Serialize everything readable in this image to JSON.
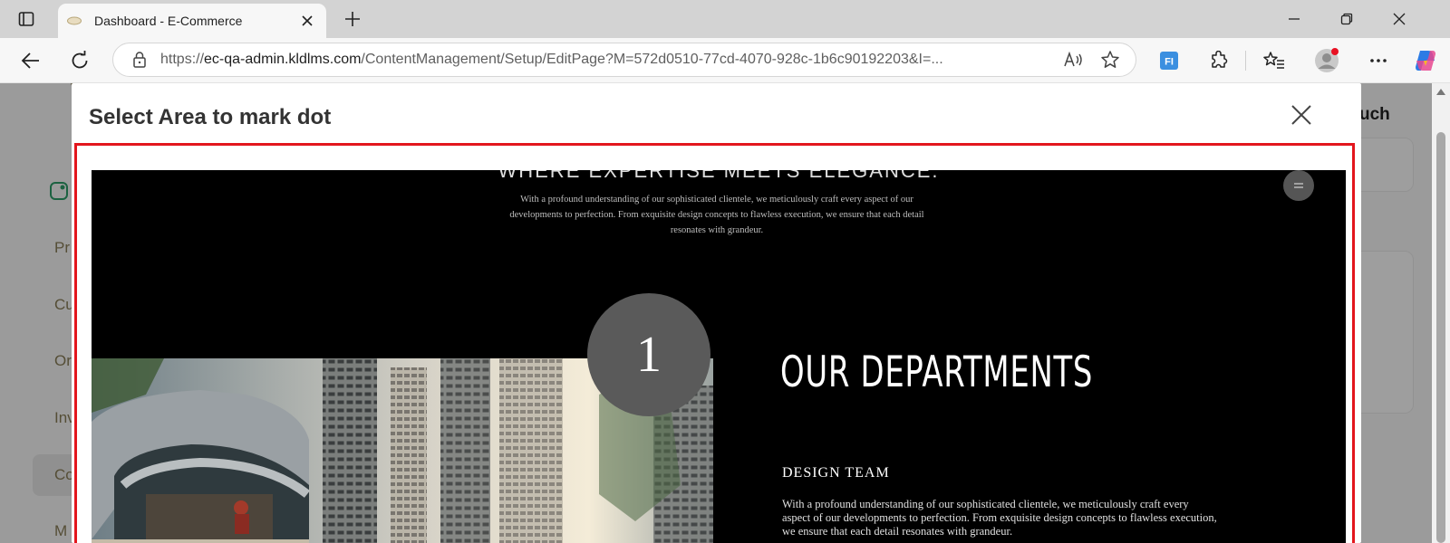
{
  "browser": {
    "tab_title": "Dashboard - E-Commerce",
    "url_prefix": "https://",
    "url_host": "ec-qa-admin.kldlms.com",
    "url_path": "/ContentManagement/Setup/EditPage?M=572d0510-77cd-4070-928c-1b6c90192203&I=..."
  },
  "background_page": {
    "search_label_partial": "uch",
    "sidebar_letters": [
      "Pr",
      "Cu",
      "Or",
      "Inv",
      "Co",
      "M"
    ]
  },
  "modal": {
    "title": "Select Area to mark dot"
  },
  "preview": {
    "hero_heading_partial": "WHERE EXPERTISE MEETS ELEGANCE.",
    "hero_body": "With a profound understanding of our sophisticated clientele, we meticulously craft every aspect of our developments to perfection. From exquisite design concepts to flawless execution, we ensure that each detail resonates with grandeur.",
    "marker_number": "1",
    "section_title": "OUR DEPARTMENTS",
    "team_title": "DESIGN TEAM",
    "team_body": "With a profound understanding of our sophisticated clientele, we meticulously craft every aspect of our developments to perfection. From exquisite design concepts to flawless execution, we ensure that each detail resonates with grandeur."
  },
  "colors": {
    "selection_border": "#e3161d",
    "marker": "#5a5a5a",
    "accent_gold": "#8a7e58"
  }
}
